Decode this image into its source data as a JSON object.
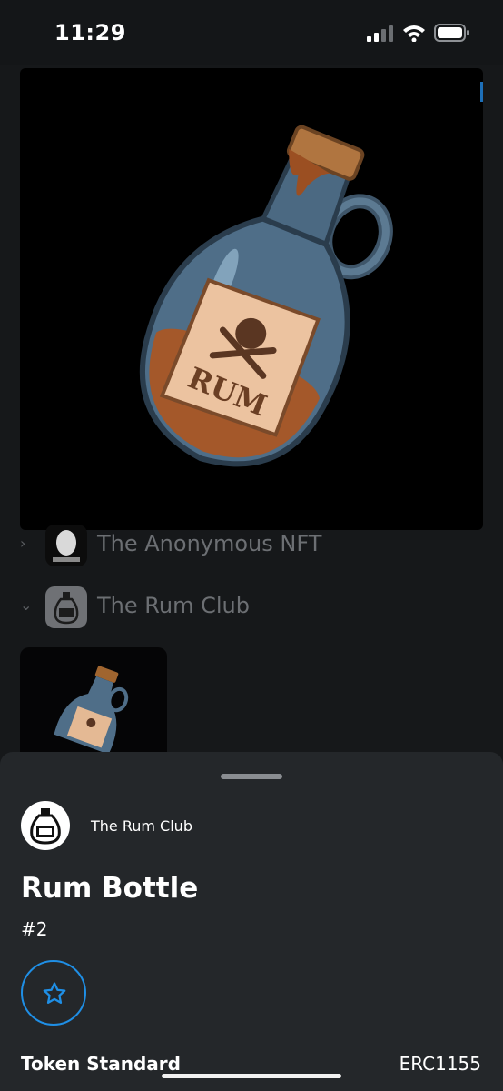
{
  "status_bar": {
    "time": "11:29",
    "icons": [
      "signal-icon",
      "wifi-icon",
      "battery-icon"
    ]
  },
  "background_list": {
    "collections": [
      {
        "label": "The Anonymous NFT",
        "thumb": "anonymous-mask-logo",
        "expanded": false
      },
      {
        "label": "The Rum Club",
        "thumb": "rum-bottle-logo",
        "expanded": true
      }
    ],
    "hero_image": "rum-bottle-illustration",
    "bottle_label_text": "RUM"
  },
  "sheet": {
    "collection_name": "The Rum Club",
    "nft_title": "Rum Bottle",
    "nft_id": "#2",
    "favorite_icon": "star-icon",
    "token_standard_label": "Token Standard",
    "token_standard_value": "ERC1155"
  },
  "colors": {
    "sheet_bg": "#24272a",
    "accent": "#1f8fe6",
    "backdrop": "#16181a"
  }
}
